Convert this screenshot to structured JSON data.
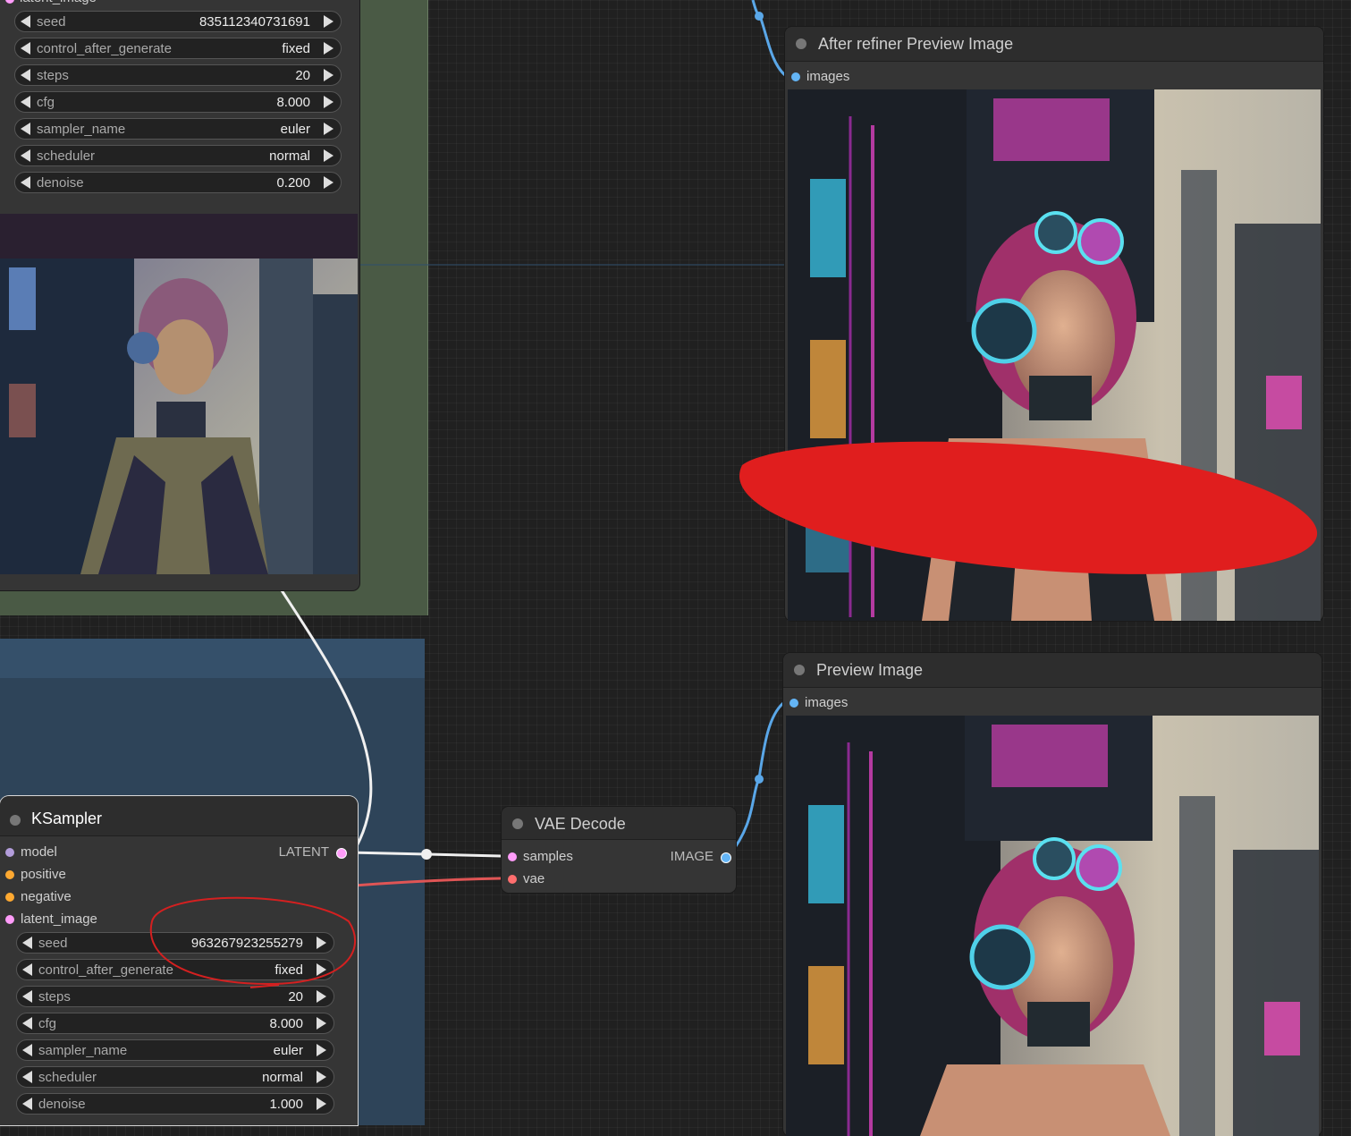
{
  "top_sampler": {
    "cut_label": "latent_image",
    "widgets": [
      {
        "name": "seed",
        "value": "835112340731691"
      },
      {
        "name": "control_after_generate",
        "value": "fixed"
      },
      {
        "name": "steps",
        "value": "20"
      },
      {
        "name": "cfg",
        "value": "8.000"
      },
      {
        "name": "sampler_name",
        "value": "euler"
      },
      {
        "name": "scheduler",
        "value": "normal"
      },
      {
        "name": "denoise",
        "value": "0.200"
      }
    ]
  },
  "ksampler": {
    "title": "KSampler",
    "inputs": [
      "model",
      "positive",
      "negative",
      "latent_image"
    ],
    "output": "LATENT",
    "widgets": [
      {
        "name": "seed",
        "value": "963267923255279"
      },
      {
        "name": "control_after_generate",
        "value": "fixed"
      },
      {
        "name": "steps",
        "value": "20"
      },
      {
        "name": "cfg",
        "value": "8.000"
      },
      {
        "name": "sampler_name",
        "value": "euler"
      },
      {
        "name": "scheduler",
        "value": "normal"
      },
      {
        "name": "denoise",
        "value": "1.000"
      }
    ]
  },
  "vae_decode": {
    "title": "VAE Decode",
    "inputs": [
      "samples",
      "vae"
    ],
    "output": "IMAGE"
  },
  "after_refiner_preview": {
    "title": "After refiner Preview Image",
    "input": "images"
  },
  "preview_image": {
    "title": "Preview Image",
    "input": "images"
  },
  "colors": {
    "canvas": "#202020",
    "node_body": "#353535",
    "node_title": "#2d2d2d",
    "group_green": "#4a5a45",
    "group_blue": "#2e4459",
    "slot_model": "#b39ddb",
    "slot_conditioning": "#ffa931",
    "slot_latent": "#ff9cf9",
    "slot_vae": "#ff6e6e",
    "slot_image": "#64b5f6",
    "annotation_red": "#e01e1e"
  }
}
